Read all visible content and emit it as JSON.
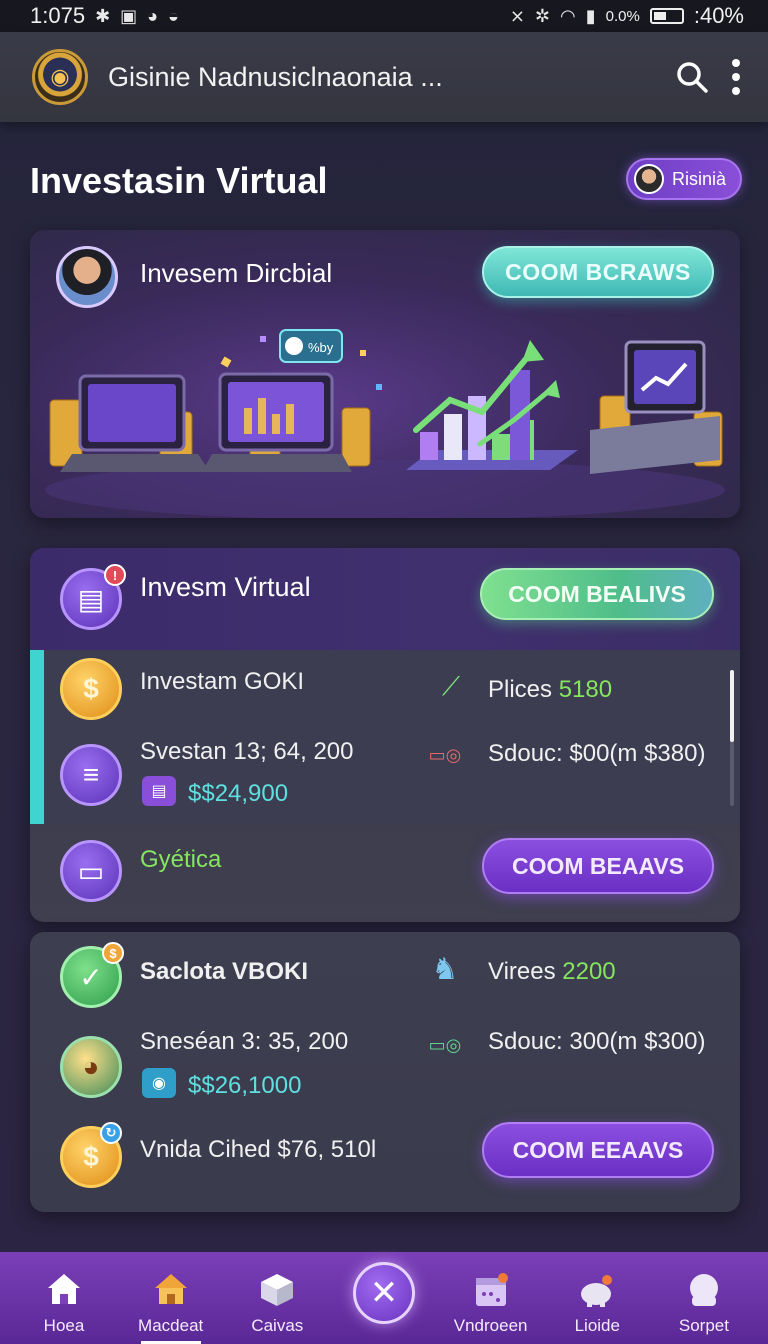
{
  "status_bar": {
    "time": "1:075",
    "left_icons": [
      "bluetooth-icon",
      "image-icon",
      "alarm-icon",
      "chat-icon"
    ],
    "right_icons": [
      "mute-icon",
      "vibrate-icon",
      "wifi-icon",
      "signal-icon"
    ],
    "data_rate": "0.0%",
    "battery_text": ":40%"
  },
  "app_bar": {
    "title": "Gisinie Nadnusiclnaonaia ...",
    "icons": [
      "app-logo-icon",
      "search-icon",
      "more-vertical-icon"
    ]
  },
  "page": {
    "title": "Investasin Virtual",
    "profile_chip_label": "Risinià"
  },
  "hero": {
    "title": "Invesem Dircbial",
    "button_label": "COOM BCRAWS",
    "art_badge": "%by"
  },
  "section1": {
    "title": "Invesm Virtual",
    "button_label": "COOM BEALIVS",
    "rows": [
      {
        "label": "Investam GOKI",
        "right_label": "Plices",
        "right_value": "5180"
      },
      {
        "label": "Svestan 13; 64, 200",
        "amount": "$$24,900",
        "right_text": "Sdouc: $00(m $380)"
      }
    ],
    "footer_label": "Gyética",
    "footer_button": "COOM BEAAVS"
  },
  "section2": {
    "rows": [
      {
        "label": "Saclota VBOKI",
        "right_label": "Virees",
        "right_value": "2200"
      },
      {
        "label": "Sneséan 3: 35, 200",
        "amount": "$$26,1000",
        "right_text": "Sdouc: 300(m $300)"
      },
      {
        "label": "Vnida Cihed $76, 510l"
      }
    ],
    "button_label": "COOM EEAAVS"
  },
  "bottom_nav": {
    "items": [
      {
        "label": "Hoea",
        "icon": "home-icon"
      },
      {
        "label": "Macdeat",
        "icon": "market-icon"
      },
      {
        "label": "Caivas",
        "icon": "box-icon"
      },
      {
        "label": "",
        "icon": "close-icon"
      },
      {
        "label": "Vndroeen",
        "icon": "calendar-icon"
      },
      {
        "label": "Lioide",
        "icon": "piggy-bank-icon"
      },
      {
        "label": "Sorpet",
        "icon": "support-icon"
      }
    ],
    "active_index": 1
  },
  "colors": {
    "accent_purple": "#7b3fb8",
    "accent_teal": "#3fd4d0",
    "value_green": "#86e55e",
    "value_cyan": "#5fe0e0"
  }
}
